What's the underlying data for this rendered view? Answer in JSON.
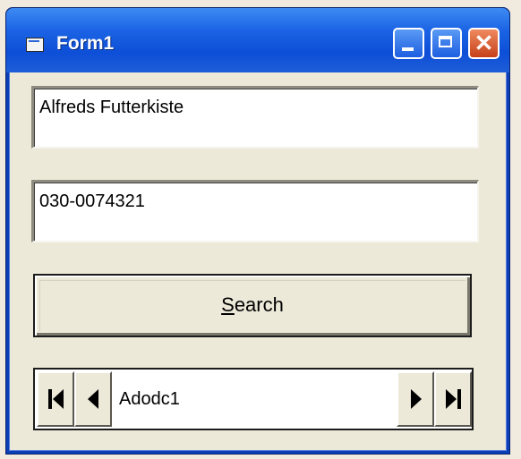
{
  "window": {
    "title": "Form1",
    "icon": "form-icon",
    "controls": [
      "minimize-icon",
      "maximize-icon",
      "close-icon"
    ]
  },
  "form": {
    "textbox1_value": "Alfreds Futterkiste",
    "textbox2_value": "030-0074321",
    "search_label_prefix": "S",
    "search_label_rest": "earch"
  },
  "adodc": {
    "caption": "Adodc1",
    "buttons": [
      "first-record-icon",
      "previous-record-icon",
      "next-record-icon",
      "last-record-icon"
    ]
  }
}
